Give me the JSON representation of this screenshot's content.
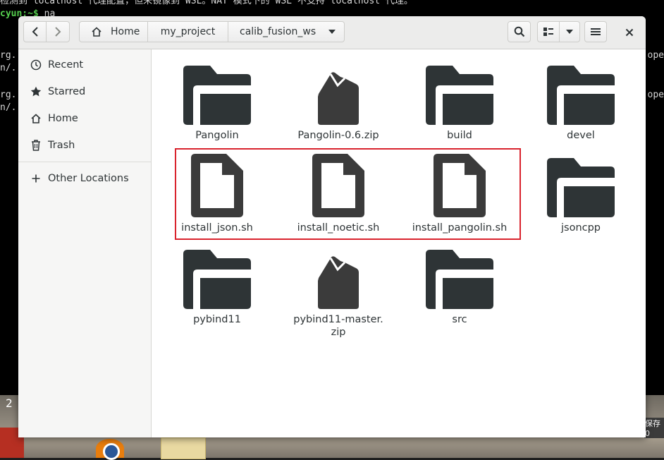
{
  "terminal": {
    "top_line": "检测到 localhost 代理配置，但未镜像到 WSL。NAT 模式下的 WSL 不支持 localhost 代理。",
    "prompt": "cyun:~$",
    "command": " na",
    "left_fragments": [
      "rg.",
      "n/.",
      "rg.",
      "n/."
    ],
    "right_fragments": [
      "ope",
      "ope"
    ],
    "bottom_left": "2",
    "bottom_right": "保存0"
  },
  "header": {
    "breadcrumbs": [
      {
        "label": "Home",
        "icon": "home-icon"
      },
      {
        "label": "my_project"
      },
      {
        "label": "calib_fusion_ws"
      }
    ],
    "buttons": [
      "back",
      "forward",
      "breadcrumb-dropdown",
      "search",
      "view-toggle",
      "view-options-dropdown",
      "menu",
      "close"
    ]
  },
  "sidebar": {
    "items": [
      {
        "label": "Recent",
        "icon": "clock-icon"
      },
      {
        "label": "Starred",
        "icon": "star-icon"
      },
      {
        "label": "Home",
        "icon": "home-icon"
      },
      {
        "label": "Trash",
        "icon": "trash-icon"
      },
      {
        "label": "Other Locations",
        "icon": "plus-icon"
      }
    ]
  },
  "files": [
    {
      "name": "Pangolin",
      "type": "folder"
    },
    {
      "name": "Pangolin-0.6.zip",
      "type": "archive"
    },
    {
      "name": "build",
      "type": "folder"
    },
    {
      "name": "devel",
      "type": "folder"
    },
    {
      "name": "install_json.sh",
      "type": "document",
      "highlighted": true
    },
    {
      "name": "install_noetic.sh",
      "type": "document",
      "highlighted": true
    },
    {
      "name": "install_pangolin.sh",
      "type": "document",
      "highlighted": true
    },
    {
      "name": "jsoncpp",
      "type": "folder"
    },
    {
      "name": "pybind11",
      "type": "folder"
    },
    {
      "name": "pybind11-master.\nzip",
      "type": "archive"
    },
    {
      "name": "src",
      "type": "folder"
    }
  ],
  "colors": {
    "icon": "#2e3436",
    "highlight_border": "#d9232d",
    "terminal_prompt": "#56d14f"
  }
}
